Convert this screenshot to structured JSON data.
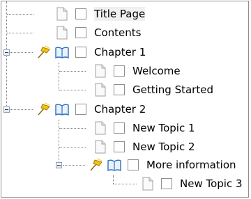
{
  "tree": {
    "items": [
      {
        "label": "Title Page",
        "icon": "page-icon",
        "level": 0,
        "selected": true
      },
      {
        "label": "Contents",
        "icon": "page-icon",
        "level": 0
      },
      {
        "label": "Chapter 1",
        "icon": "book-icon",
        "level": 0,
        "expanded": true,
        "pinned": true
      },
      {
        "label": "Welcome",
        "icon": "page-icon",
        "level": 1
      },
      {
        "label": "Getting Started",
        "icon": "page-icon",
        "level": 1
      },
      {
        "label": "Chapter 2",
        "icon": "book-icon",
        "level": 0,
        "expanded": true,
        "pinned": true
      },
      {
        "label": "New Topic 1",
        "icon": "page-icon",
        "level": 1
      },
      {
        "label": "New Topic 2",
        "icon": "page-icon",
        "level": 1
      },
      {
        "label": "More information",
        "icon": "book-icon",
        "level": 1,
        "expanded": true,
        "pinned": true
      },
      {
        "label": "New Topic 3",
        "icon": "page-icon",
        "level": 2
      }
    ]
  },
  "colors": {
    "line": "#808080",
    "book_blue": "#2a6fc1",
    "pin_yellow": "#f2c40f"
  }
}
